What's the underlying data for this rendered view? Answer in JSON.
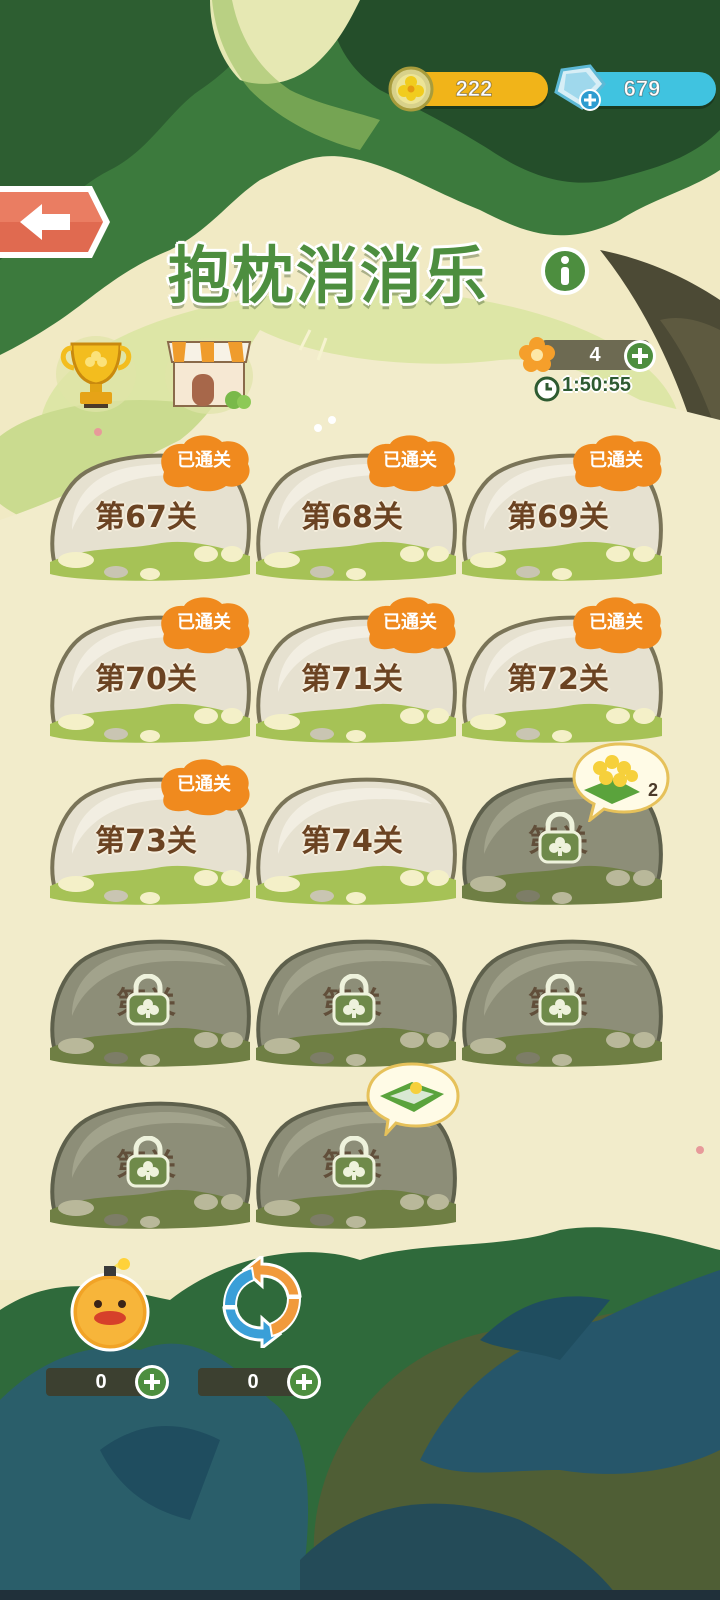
{
  "currency": {
    "coins": "222",
    "gems": "679"
  },
  "title": "抱枕消消乐",
  "lives": {
    "count": "4",
    "timer": "1:50:55"
  },
  "completed_badge": "已通关",
  "levels": [
    {
      "label": "第67关",
      "state": "cleared"
    },
    {
      "label": "第68关",
      "state": "cleared"
    },
    {
      "label": "第69关",
      "state": "cleared"
    },
    {
      "label": "第70关",
      "state": "cleared"
    },
    {
      "label": "第71关",
      "state": "cleared"
    },
    {
      "label": "第72关",
      "state": "cleared"
    },
    {
      "label": "第73关",
      "state": "cleared"
    },
    {
      "label": "第74关",
      "state": "unlocked"
    },
    {
      "label": "第关",
      "state": "locked"
    },
    {
      "label": "第关",
      "state": "locked"
    },
    {
      "label": "第关",
      "state": "locked"
    },
    {
      "label": "第关",
      "state": "locked"
    },
    {
      "label": "第关",
      "state": "locked"
    },
    {
      "label": "第关",
      "state": "locked"
    }
  ],
  "reward_bubble": {
    "count": "2"
  },
  "boosters": [
    {
      "name": "chick-bomb",
      "count": "0"
    },
    {
      "name": "shuffle",
      "count": "0"
    }
  ],
  "icons": [
    "back-arrow-icon",
    "trophy-icon",
    "shop-icon",
    "info-icon",
    "flower-icon",
    "clock-icon",
    "plus-icon",
    "lock-icon",
    "coin-icon",
    "gem-icon"
  ]
}
